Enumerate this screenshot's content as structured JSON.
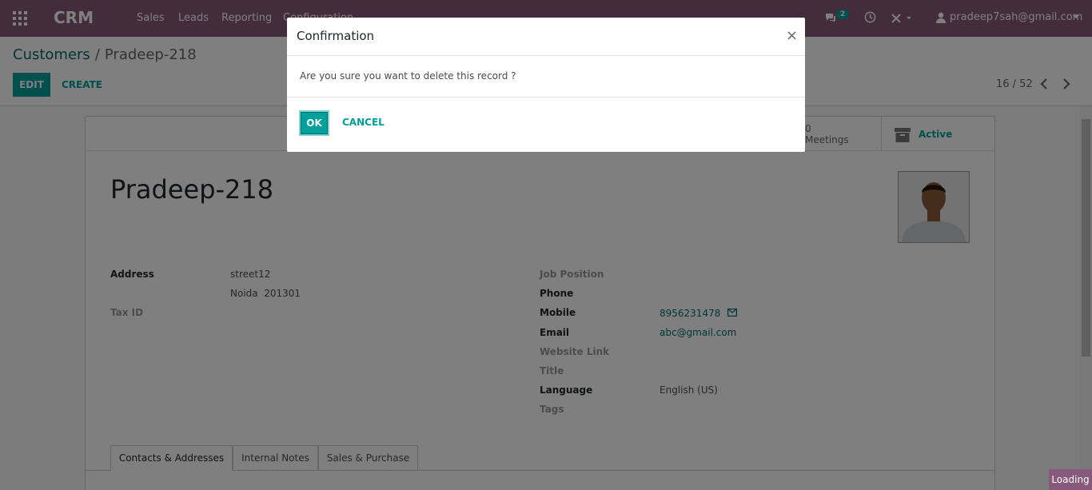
{
  "navbar": {
    "brand": "CRM",
    "menu": [
      "Sales",
      "Leads",
      "Reporting",
      "Configuration"
    ],
    "chat_count": "2",
    "user": "pradeep7sah@gmail.com"
  },
  "control_panel": {
    "breadcrumb_parent": "Customers",
    "breadcrumb_separator": "/",
    "breadcrumb_current": "Pradeep-218",
    "edit_label": "EDIT",
    "create_label": "CREATE",
    "pager_value": "16 / 52"
  },
  "stats": {
    "meetings_count": "0",
    "meetings_label": "Meetings",
    "active_label": "Active"
  },
  "record": {
    "name": "Pradeep-218",
    "left_fields": [
      {
        "label": "Address",
        "values": [
          "street12",
          "Noida  201301"
        ]
      },
      {
        "label": "Tax ID",
        "values": []
      }
    ],
    "right_fields": [
      {
        "label": "Job Position",
        "value": ""
      },
      {
        "label": "Phone",
        "value": ""
      },
      {
        "label": "Mobile",
        "value": "8956231478"
      },
      {
        "label": "Email",
        "value": "abc@gmail.com"
      },
      {
        "label": "Website Link",
        "value": ""
      },
      {
        "label": "Title",
        "value": ""
      },
      {
        "label": "Language",
        "value": "English (US)"
      },
      {
        "label": "Tags",
        "value": ""
      }
    ]
  },
  "tabs": [
    "Contacts & Addresses",
    "Internal Notes",
    "Sales & Purchase"
  ],
  "dialog": {
    "title": "Confirmation",
    "close": "×",
    "message": "Are you sure you want to delete this record ?",
    "ok_label": "OK",
    "cancel_label": "CANCEL"
  },
  "status": {
    "loading": "Loading"
  },
  "colors": {
    "navbar": "#875a7b",
    "primary": "#00a09d",
    "link": "#006d6b"
  },
  "icons": [
    "apps-icon",
    "chat-icon",
    "clock-icon",
    "debug-icon",
    "user-icon",
    "chevron-left-icon",
    "chevron-right-icon",
    "archive-icon",
    "envelope-icon",
    "close-icon"
  ]
}
